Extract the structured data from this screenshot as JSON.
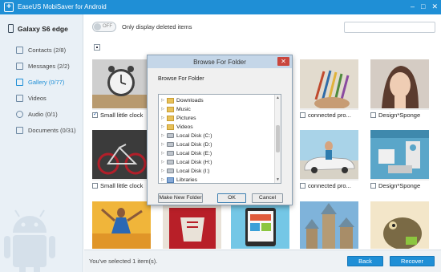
{
  "window": {
    "title": "EaseUS MobiSaver for Android",
    "app_icon": "+",
    "controls": [
      "–",
      "□",
      "✕"
    ]
  },
  "sidebar": {
    "device_name": "Galaxy S6 edge",
    "items": [
      {
        "label": "Contacts (2/8)",
        "icon": "contacts-icon",
        "active": false
      },
      {
        "label": "Messages (2/2)",
        "icon": "messages-icon",
        "active": false
      },
      {
        "label": "Gallery (0/77)",
        "icon": "gallery-icon",
        "active": true
      },
      {
        "label": "Videos",
        "icon": "videos-icon",
        "active": false
      },
      {
        "label": "Audio (0/1)",
        "icon": "audio-icon",
        "active": false
      },
      {
        "label": "Documents (0/31)",
        "icon": "documents-icon",
        "active": false
      }
    ]
  },
  "topbar": {
    "toggle_state": "OFF",
    "toggle_label": "Only display deleted items",
    "search_placeholder": ""
  },
  "gallery": {
    "items": [
      {
        "caption": "Small little clock",
        "checked": true,
        "colors": [
          "#cfcfcf",
          "#404040"
        ]
      },
      {
        "caption": "connected pro...",
        "checked": false,
        "colors": [
          "#e2dbce",
          "#8a6a3a"
        ]
      },
      {
        "caption": "Design*Sponge",
        "checked": false,
        "colors": [
          "#d5ccc4",
          "#5b3b2e"
        ]
      },
      {
        "caption": "Small little clock",
        "checked": false,
        "colors": [
          "#3b3b3b",
          "#b11f2a"
        ]
      },
      {
        "caption": "connected pro...",
        "checked": false,
        "colors": [
          "#a9d3e8",
          "#e4e4e4"
        ]
      },
      {
        "caption": "Design*Sponge",
        "checked": false,
        "colors": [
          "#5aa6c9",
          "#f0f0f0"
        ]
      },
      {
        "caption": "",
        "checked": false,
        "colors": [
          "#f0b53a",
          "#2b68b3"
        ]
      },
      {
        "caption": "",
        "checked": false,
        "colors": [
          "#b81f28",
          "#e9e2d8"
        ]
      },
      {
        "caption": "",
        "checked": false,
        "colors": [
          "#74c7e6",
          "#2d2d2d"
        ]
      },
      {
        "caption": "",
        "checked": false,
        "colors": [
          "#7fb3da",
          "#b59b74"
        ]
      },
      {
        "caption": "",
        "checked": false,
        "colors": [
          "#f3e6c9",
          "#7a6a45"
        ]
      }
    ]
  },
  "status": {
    "selected_text": "You've selected 1 item(s)."
  },
  "buttons": {
    "back": "Back",
    "recover": "Recover"
  },
  "dialog": {
    "title": "Browse For Folder",
    "label": "Browse For Folder",
    "close": "✕",
    "tree": [
      {
        "label": "Downloads",
        "type": "folder"
      },
      {
        "label": "Music",
        "type": "folder"
      },
      {
        "label": "Pictures",
        "type": "folder"
      },
      {
        "label": "Videos",
        "type": "folder"
      },
      {
        "label": "Local Disk (C:)",
        "type": "drive"
      },
      {
        "label": "Local Disk (D:)",
        "type": "drive"
      },
      {
        "label": "Local Disk (E:)",
        "type": "drive"
      },
      {
        "label": "Local Disk (H:)",
        "type": "drive"
      },
      {
        "label": "Local Disk (I:)",
        "type": "drive"
      },
      {
        "label": "Libraries",
        "type": "library"
      }
    ],
    "make_new_folder": "Make New Folder",
    "ok": "OK",
    "cancel": "Cancel"
  }
}
